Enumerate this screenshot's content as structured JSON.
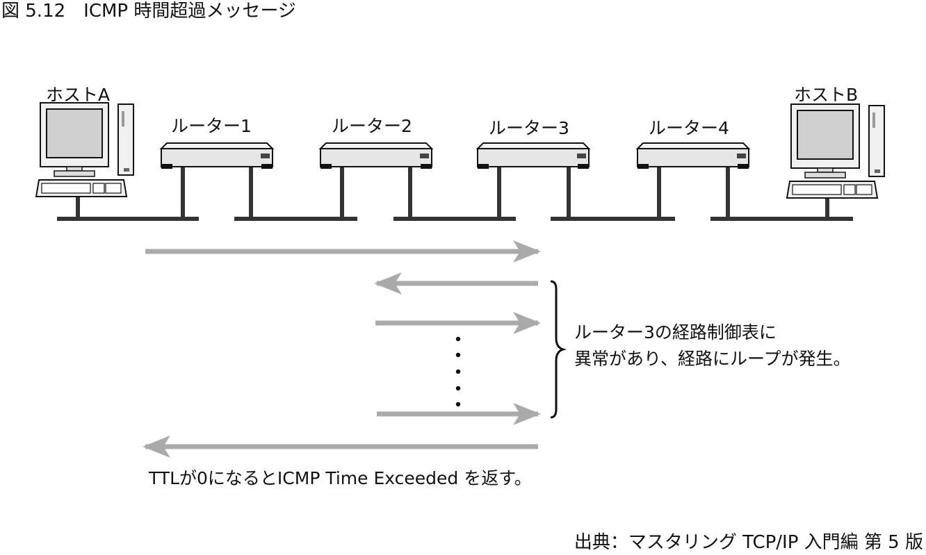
{
  "figure": {
    "title": "図 5.12　ICMP 時間超過メッセージ",
    "source": "出典：マスタリング TCP/IP 入門編 第 5 版"
  },
  "hosts": [
    {
      "label": "ホストA",
      "icon": "desktop-computer-icon"
    },
    {
      "label": "ホストB",
      "icon": "desktop-computer-icon"
    }
  ],
  "routers": [
    {
      "label": "ルーター1",
      "icon": "router-icon"
    },
    {
      "label": "ルーター2",
      "icon": "router-icon"
    },
    {
      "label": "ルーター3",
      "icon": "router-icon"
    },
    {
      "label": "ルーター4",
      "icon": "router-icon"
    }
  ],
  "annotations": {
    "loop_line1": "ルーター3の経路制御表に",
    "loop_line2": "異常があり、経路にループが発生。",
    "ttl_note": "TTLが0になるとICMP Time Exceeded を返す。"
  },
  "colors": {
    "arrow": "#aaaaaa",
    "device_fill": "#e6e6e6",
    "line": "#333333"
  }
}
